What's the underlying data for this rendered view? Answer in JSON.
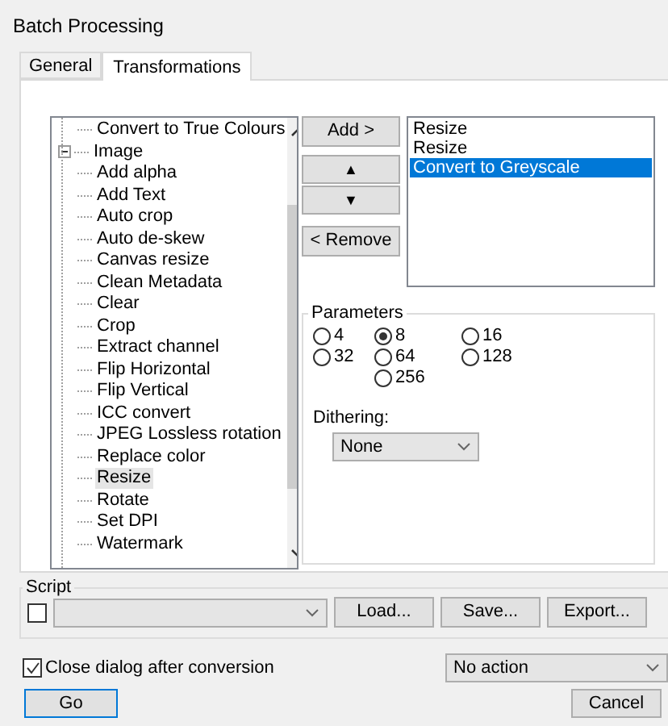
{
  "window": {
    "title": "Batch Processing"
  },
  "tabs": [
    {
      "label": "General",
      "selected": false
    },
    {
      "label": "Transformations",
      "selected": true
    }
  ],
  "tree": {
    "continued_children": [
      {
        "label": "Convert to True Colours",
        "selected": false
      }
    ],
    "items": [
      {
        "label": "Image",
        "expanded": true,
        "children": [
          {
            "label": "Add alpha",
            "selected": false
          },
          {
            "label": "Add Text",
            "selected": false
          },
          {
            "label": "Auto crop",
            "selected": false
          },
          {
            "label": "Auto de-skew",
            "selected": false
          },
          {
            "label": "Canvas resize",
            "selected": false
          },
          {
            "label": "Clean Metadata",
            "selected": false
          },
          {
            "label": "Clear",
            "selected": false
          },
          {
            "label": "Crop",
            "selected": false
          },
          {
            "label": "Extract channel",
            "selected": false
          },
          {
            "label": "Flip Horizontal",
            "selected": false
          },
          {
            "label": "Flip Vertical",
            "selected": false
          },
          {
            "label": "ICC convert",
            "selected": false
          },
          {
            "label": "JPEG Lossless rotation",
            "selected": false
          },
          {
            "label": "Replace color",
            "selected": false
          },
          {
            "label": "Resize",
            "selected": true
          },
          {
            "label": "Rotate",
            "selected": false
          },
          {
            "label": "Set DPI",
            "selected": false
          },
          {
            "label": "Watermark",
            "selected": false
          }
        ]
      }
    ]
  },
  "add_button": "Add >",
  "up_button": "▲",
  "down_button": "▼",
  "remove_button": "< Remove",
  "transform_list": [
    {
      "label": "Resize",
      "selected": false
    },
    {
      "label": "Resize",
      "selected": false
    },
    {
      "label": "Convert to Greyscale",
      "selected": true
    }
  ],
  "parameters": {
    "title": "Parameters",
    "options": [
      {
        "label": "4",
        "selected": false
      },
      {
        "label": "8",
        "selected": true
      },
      {
        "label": "16",
        "selected": false
      },
      {
        "label": "32",
        "selected": false
      },
      {
        "label": "64",
        "selected": false
      },
      {
        "label": "128",
        "selected": false
      },
      {
        "label": "256",
        "selected": false
      }
    ],
    "dithering_label": "Dithering:",
    "dithering_value": "None"
  },
  "script": {
    "title": "Script",
    "checked": false,
    "load_button": "Load...",
    "save_button": "Save...",
    "export_button": "Export..."
  },
  "close_after": {
    "label": "Close dialog after conversion",
    "checked": true
  },
  "action_value": "No action",
  "go_button": "Go",
  "cancel_button": "Cancel"
}
